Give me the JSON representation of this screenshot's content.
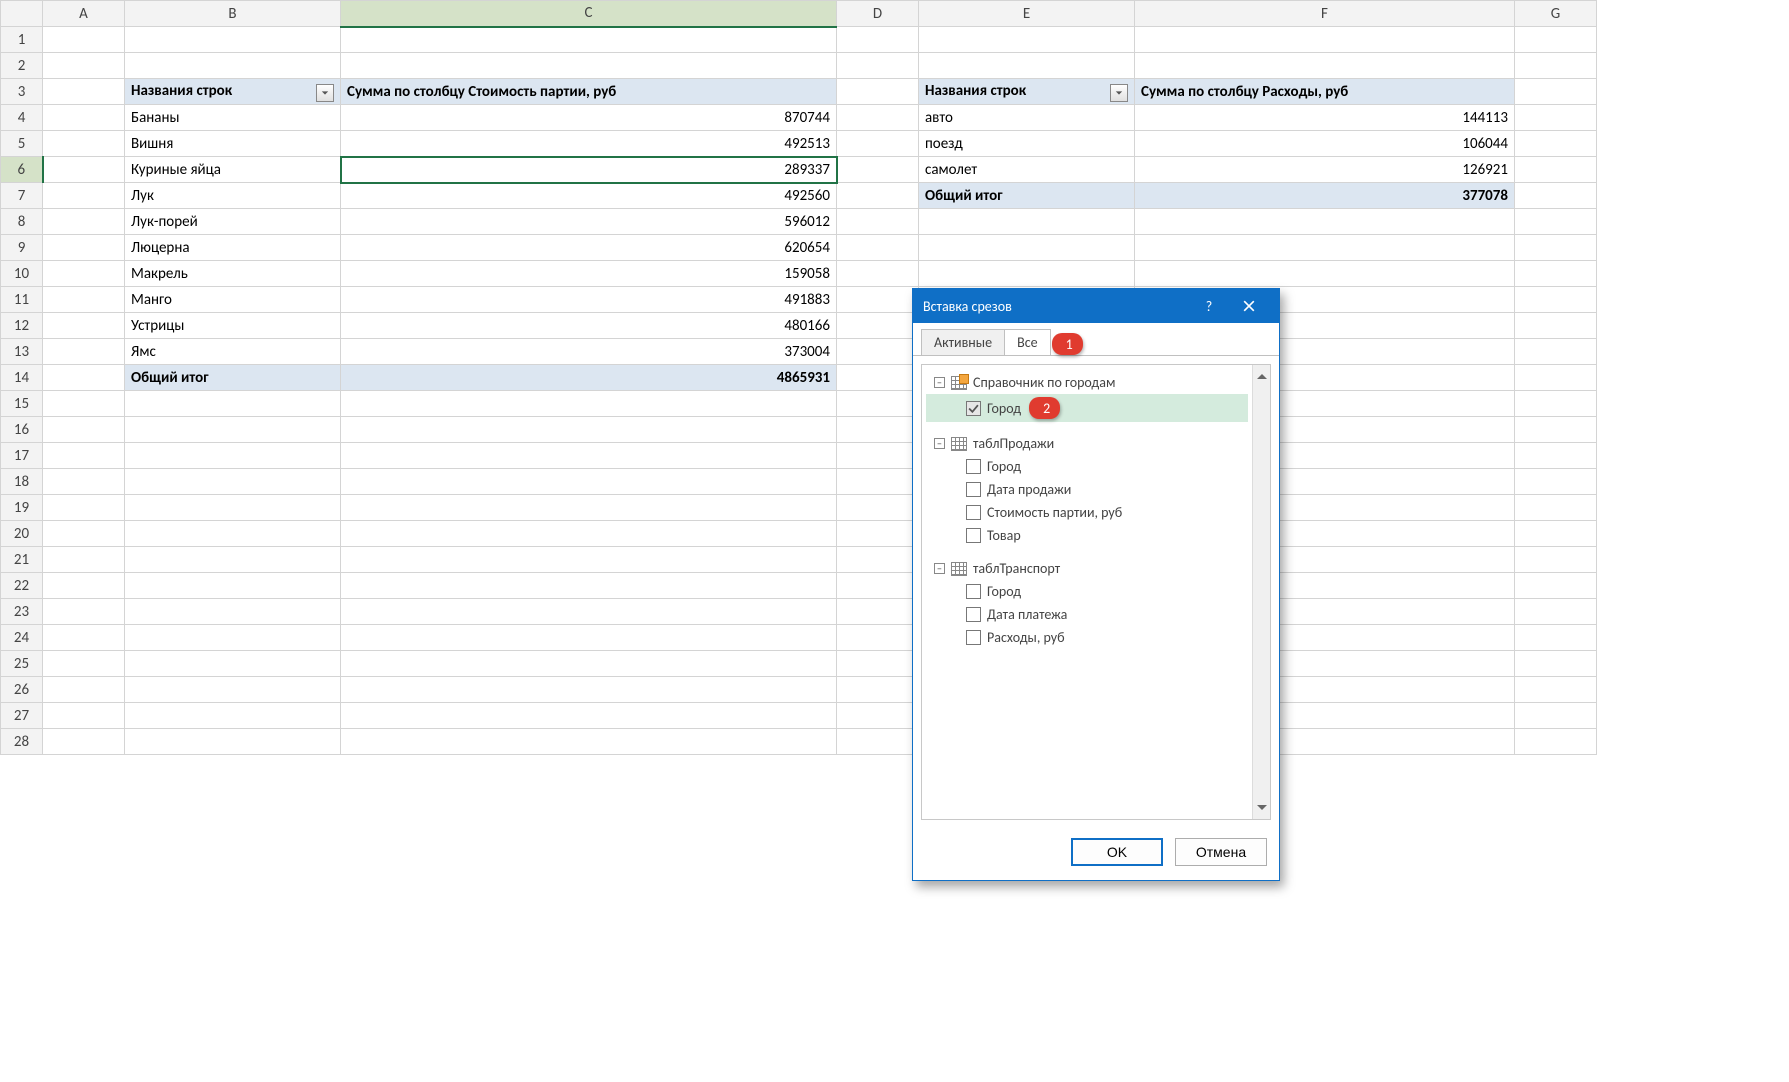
{
  "grid": {
    "columns": [
      "A",
      "B",
      "C",
      "D",
      "E",
      "F",
      "G"
    ],
    "row_count": 28,
    "selected_col": "C",
    "selected_row": 6
  },
  "pivot1": {
    "header_row_label": "Названия строк",
    "header_value_label": "Сумма по столбцу Стоимость партии, руб",
    "rows": [
      {
        "label": "Бананы",
        "value": "870744"
      },
      {
        "label": "Вишня",
        "value": "492513"
      },
      {
        "label": "Куриные яйца",
        "value": "289337"
      },
      {
        "label": "Лук",
        "value": "492560"
      },
      {
        "label": "Лук-порей",
        "value": "596012"
      },
      {
        "label": "Люцерна",
        "value": "620654"
      },
      {
        "label": "Макрель",
        "value": "159058"
      },
      {
        "label": "Манго",
        "value": "491883"
      },
      {
        "label": "Устрицы",
        "value": "480166"
      },
      {
        "label": "Ямс",
        "value": "373004"
      }
    ],
    "total_label": "Общий итог",
    "total_value": "4865931"
  },
  "pivot2": {
    "header_row_label": "Названия строк",
    "header_value_label": "Сумма по столбцу Расходы, руб",
    "rows": [
      {
        "label": "авто",
        "value": "144113"
      },
      {
        "label": "поезд",
        "value": "106044"
      },
      {
        "label": "самолет",
        "value": "126921"
      }
    ],
    "total_label": "Общий итог",
    "total_value": "377078"
  },
  "dialog": {
    "title": "Вставка срезов",
    "tabs": {
      "active_label": "Активные",
      "all_label": "Все"
    },
    "callouts": {
      "one": "1",
      "two": "2"
    },
    "tree": [
      {
        "name": "Справочник по городам",
        "icon": "orange",
        "fields": [
          {
            "label": "Город",
            "checked": true,
            "highlight": true,
            "callout": "2"
          }
        ]
      },
      {
        "name": "таблПродажи",
        "icon": "plain",
        "fields": [
          {
            "label": "Город",
            "checked": false
          },
          {
            "label": "Дата продажи",
            "checked": false
          },
          {
            "label": "Стоимость партии, руб",
            "checked": false
          },
          {
            "label": "Товар",
            "checked": false
          }
        ]
      },
      {
        "name": "таблТранспорт",
        "icon": "plain",
        "fields": [
          {
            "label": "Город",
            "checked": false
          },
          {
            "label": "Дата платежа",
            "checked": false
          },
          {
            "label": "Расходы, руб",
            "checked": false
          }
        ]
      }
    ],
    "buttons": {
      "ok": "OK",
      "cancel": "Отмена"
    }
  }
}
